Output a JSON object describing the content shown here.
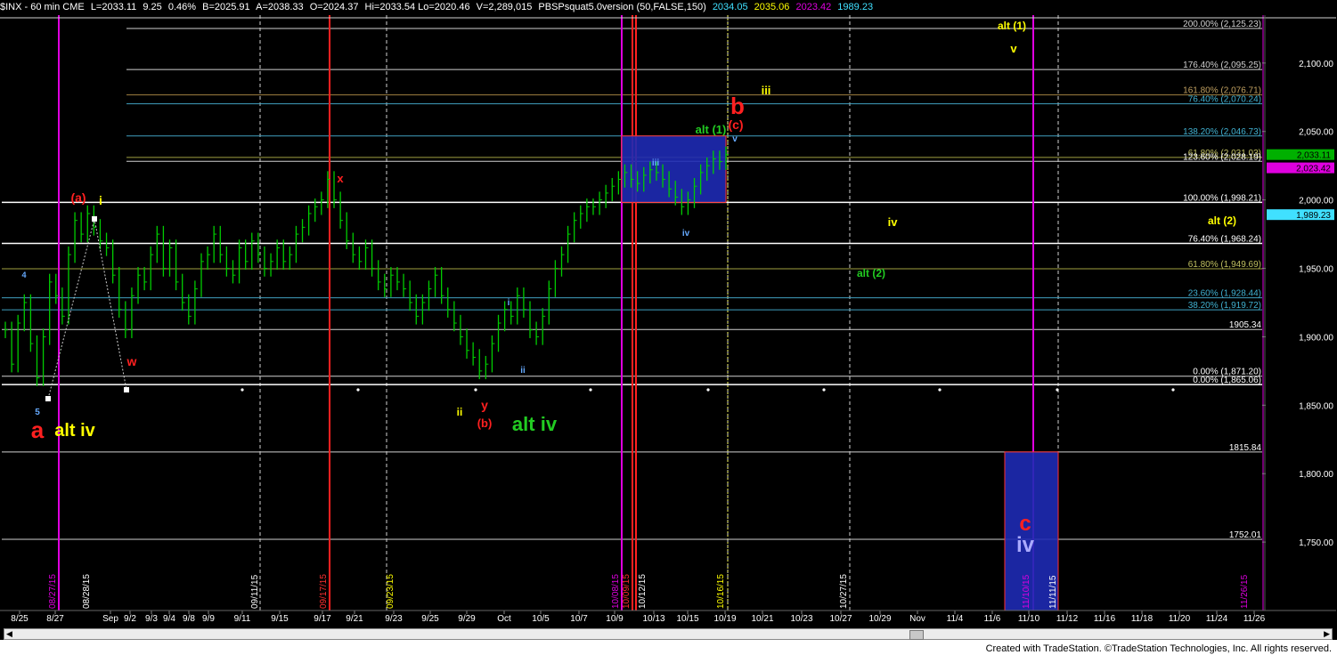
{
  "header": {
    "symbol": "$INX - 60 min  CME",
    "last": "L=2033.11",
    "chg": "9.25",
    "pct": "0.46%",
    "bid": "B=2025.91",
    "ask": "A=2038.33",
    "open": "O=2024.37",
    "hilo": "Hi=2033.54  Lo=2020.46",
    "vol": "V=2,289,015",
    "study": "PBSPsquat5.0version (50,FALSE,150)",
    "v1": "2034.05",
    "v2": "2035.06",
    "v3": "2023.42",
    "v4": "1989.23"
  },
  "footer": {
    "credit": "Created with TradeStation. ©TradeStation Technologies, Inc. All rights reserved."
  },
  "colors": {
    "price": "#00cc00",
    "fib_lines": "#d0d0d0",
    "magenta": "#e000e0",
    "red": "#ff2020",
    "yellow": "#ffff00",
    "green_label": "#22cc22",
    "blue_box": "#1e2ab4"
  },
  "chart_data": {
    "type": "line",
    "title": "",
    "xlabel": "",
    "ylabel": "",
    "ylim": [
      1700,
      2135
    ],
    "y_ticks": [
      "2,100.00",
      "2,050.00",
      "2,000.00",
      "1,950.00",
      "1,900.00",
      "1,850.00",
      "1,800.00",
      "1,750.00"
    ],
    "x_ticks": [
      "8/25",
      "8/27",
      "Sep",
      "9/2",
      "9/3",
      "9/4",
      "9/8",
      "9/9",
      "9/11",
      "9/15",
      "9/17",
      "9/21",
      "9/23",
      "9/25",
      "9/29",
      "Oct",
      "10/5",
      "10/7",
      "10/9",
      "10/13",
      "10/15",
      "10/19",
      "10/21",
      "10/23",
      "10/27",
      "10/29",
      "Nov",
      "11/4",
      "11/6",
      "11/10",
      "11/12",
      "11/16",
      "11/18",
      "11/20",
      "11/24",
      "11/26"
    ],
    "date_labels": [
      "08/27/15",
      "08/28/15",
      "09/11/15",
      "09/17/15",
      "09/23/15",
      "10/08/15",
      "10/09/15",
      "10/12/15",
      "10/16/15",
      "10/27/15",
      "11/10/15",
      "11/11/15",
      "11/26/15"
    ],
    "series": [
      {
        "values": [
          1905,
          1880,
          1910,
          1925,
          1895,
          1870,
          1900,
          1940,
          1930,
          1915,
          1960,
          1985,
          1975,
          1990,
          1980,
          1970,
          1965,
          1945,
          1920,
          1905,
          1930,
          1945,
          1940,
          1960,
          1975,
          1950,
          1965,
          1940,
          1925,
          1915,
          1935,
          1955,
          1960,
          1975,
          1960,
          1950,
          1945,
          1965,
          1955,
          1970,
          1960,
          1950,
          1955,
          1965,
          1955,
          1960,
          1975,
          1980,
          1990,
          1995,
          2000,
          2015,
          2000,
          1985,
          1970,
          1960,
          1955,
          1965,
          1950,
          1940,
          1935,
          1945,
          1940,
          1935,
          1925,
          1915,
          1925,
          1935,
          1945,
          1930,
          1920,
          1910,
          1900,
          1890,
          1885,
          1875,
          1880,
          1895,
          1910,
          1920,
          1915,
          1930,
          1920,
          1905,
          1900,
          1915,
          1935,
          1950,
          1960,
          1975,
          1985,
          1990,
          1995,
          1995,
          2000,
          2005,
          2010,
          2015,
          2020,
          2015,
          2012,
          2018,
          2022,
          2020,
          2015,
          2008,
          2002,
          1995,
          2000,
          2010,
          2020,
          2025,
          2030,
          2028,
          2033
        ]
      }
    ],
    "fib_levels": [
      {
        "label": "200.00% (2,125.23)",
        "value": 2125.23
      },
      {
        "label": "176.40% (2,095.25)",
        "value": 2095.25
      },
      {
        "label": "161.80% (2,076.71)",
        "value": 2076.71
      },
      {
        "label": "76.40% (2,070.24)",
        "value": 2070.24
      },
      {
        "label": "138.20% (2,046.73)",
        "value": 2046.73
      },
      {
        "label": "61.80% (2,031.03)",
        "value": 2031.03
      },
      {
        "label": "123.60% (2,028.19)",
        "value": 2028.19
      },
      {
        "label": "100.00% (1,998.21)",
        "value": 1998.21
      },
      {
        "label": "76.40% (1,968.24)",
        "value": 1968.24
      },
      {
        "label": "61.80% (1,949.69)",
        "value": 1949.69
      },
      {
        "label": "23.60% (1,928.44)",
        "value": 1928.44
      },
      {
        "label": "38.20% (1,919.72)",
        "value": 1919.72
      },
      {
        "label": "1905.34",
        "value": 1905.34
      },
      {
        "label": "0.00% (1,871.20)",
        "value": 1871.2
      },
      {
        "label": "0.00% (1,865.06)",
        "value": 1865.06
      },
      {
        "label": "1815.84",
        "value": 1815.84
      },
      {
        "label": "1752.01",
        "value": 1752.01
      }
    ],
    "price_tags": [
      {
        "label": "2,033.11",
        "value": 2033.11,
        "color": "#00b000"
      },
      {
        "label": "2,023.42",
        "value": 2023.42,
        "color": "#e000e0"
      },
      {
        "label": "1,989.23",
        "value": 1989.23,
        "color": "#40e0ff"
      }
    ],
    "wave_labels": [
      {
        "text": "a",
        "color": "#ff2020",
        "size": "big"
      },
      {
        "text": "alt iv",
        "color": "#ffff00",
        "size": "mid"
      },
      {
        "text": "(a)",
        "color": "#ff2020",
        "size": "small"
      },
      {
        "text": "i",
        "color": "#ffff00",
        "size": "small"
      },
      {
        "text": "w",
        "color": "#ff2020",
        "size": "small"
      },
      {
        "text": "x",
        "color": "#ff2020",
        "size": "small"
      },
      {
        "text": "ii",
        "color": "#ffff00",
        "size": "small"
      },
      {
        "text": "y",
        "color": "#ff2020",
        "size": "small"
      },
      {
        "text": "(b)",
        "color": "#ff2020",
        "size": "small"
      },
      {
        "text": "alt iv",
        "color": "#22cc22",
        "size": "mid"
      },
      {
        "text": "i",
        "color": "#66aaff",
        "size": "tiny"
      },
      {
        "text": "ii",
        "color": "#66aaff",
        "size": "tiny"
      },
      {
        "text": "iii",
        "color": "#66aaff",
        "size": "tiny"
      },
      {
        "text": "iv",
        "color": "#66aaff",
        "size": "tiny"
      },
      {
        "text": "v",
        "color": "#66aaff",
        "size": "tiny"
      },
      {
        "text": "alt (1)",
        "color": "#22cc22",
        "size": "small"
      },
      {
        "text": "b",
        "color": "#ff2020",
        "size": "big"
      },
      {
        "text": "(c)",
        "color": "#ff2020",
        "size": "small"
      },
      {
        "text": "iii",
        "color": "#ffff00",
        "size": "small"
      },
      {
        "text": "alt (1)",
        "color": "#ffff00",
        "size": "small"
      },
      {
        "text": "v",
        "color": "#ffff00",
        "size": "small"
      },
      {
        "text": "iv",
        "color": "#ffff00",
        "size": "small"
      },
      {
        "text": "alt (2)",
        "color": "#ffff00",
        "size": "small"
      },
      {
        "text": "alt (2)",
        "color": "#22cc22",
        "size": "small"
      },
      {
        "text": "c",
        "color": "#ff2020",
        "size": "big"
      },
      {
        "text": "iv",
        "color": "#aaaaff",
        "size": "big"
      },
      {
        "text": "4",
        "color": "#66aaff",
        "size": "tiny"
      },
      {
        "text": "5",
        "color": "#66aaff",
        "size": "tiny"
      }
    ]
  }
}
